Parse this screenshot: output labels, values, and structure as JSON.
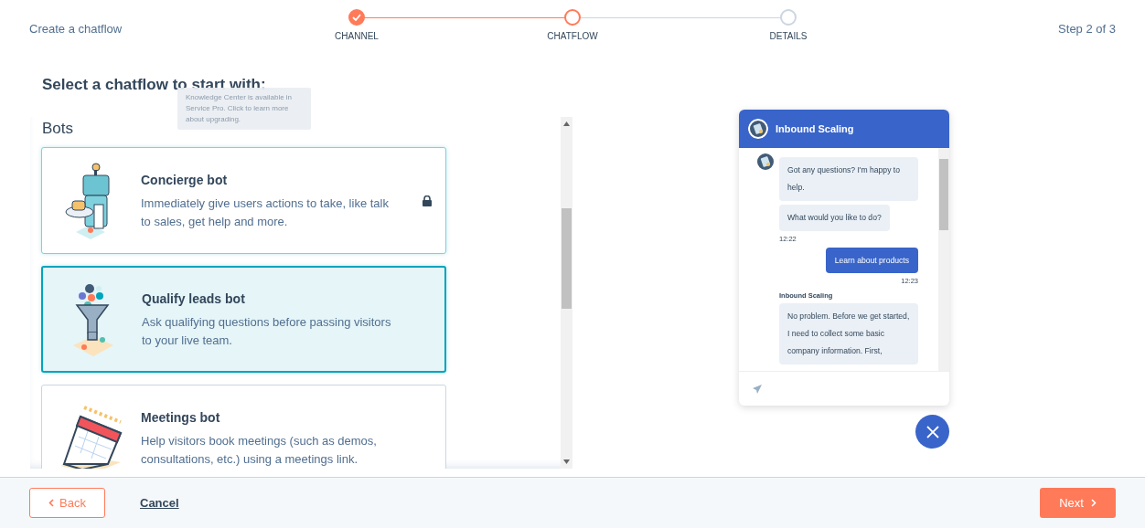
{
  "header": {
    "title": "Create a chatflow",
    "step_counter": "Step 2 of 3"
  },
  "steps": [
    {
      "label": "CHANNEL",
      "done": true,
      "selected": false
    },
    {
      "label": "CHATFLOW",
      "done": false,
      "selected": true
    },
    {
      "label": "DETAILS",
      "done": false,
      "selected": false
    }
  ],
  "heading": "Select a chatflow to start with:",
  "section_title": "Bots",
  "tooltip": "Knowledge Center is available in Service Pro. Click to learn more about upgrading.",
  "cards": [
    {
      "kind": "robot",
      "title": "Concierge bot",
      "description": "Immediately give users actions to take, like talk to sales, get help and more.",
      "selected": false,
      "locked": true
    },
    {
      "kind": "funnel",
      "title": "Qualify leads bot",
      "description": "Ask qualifying questions before passing visitors to your live team.",
      "selected": true,
      "locked": false
    },
    {
      "kind": "calendar",
      "title": "Meetings bot",
      "description": "Help visitors book meetings (such as demos, consultations, etc.) using a meetings link.",
      "selected": false,
      "locked": false
    }
  ],
  "chat": {
    "title": "Inbound Scaling",
    "messages": [
      {
        "kind": "bot",
        "text": "Got any questions? I'm happy to help.",
        "avatar": true
      },
      {
        "kind": "bot",
        "text": "What would you like to do?",
        "time": "12:22"
      },
      {
        "kind": "user",
        "text": "Learn about products",
        "time": "12:23"
      },
      {
        "kind": "bot",
        "sender": "Inbound Scaling",
        "text": "No problem. Before we get started, I need to collect some basic company information. First,"
      }
    ]
  },
  "footer": {
    "back": "Back",
    "cancel": "Cancel",
    "next": "Next"
  }
}
